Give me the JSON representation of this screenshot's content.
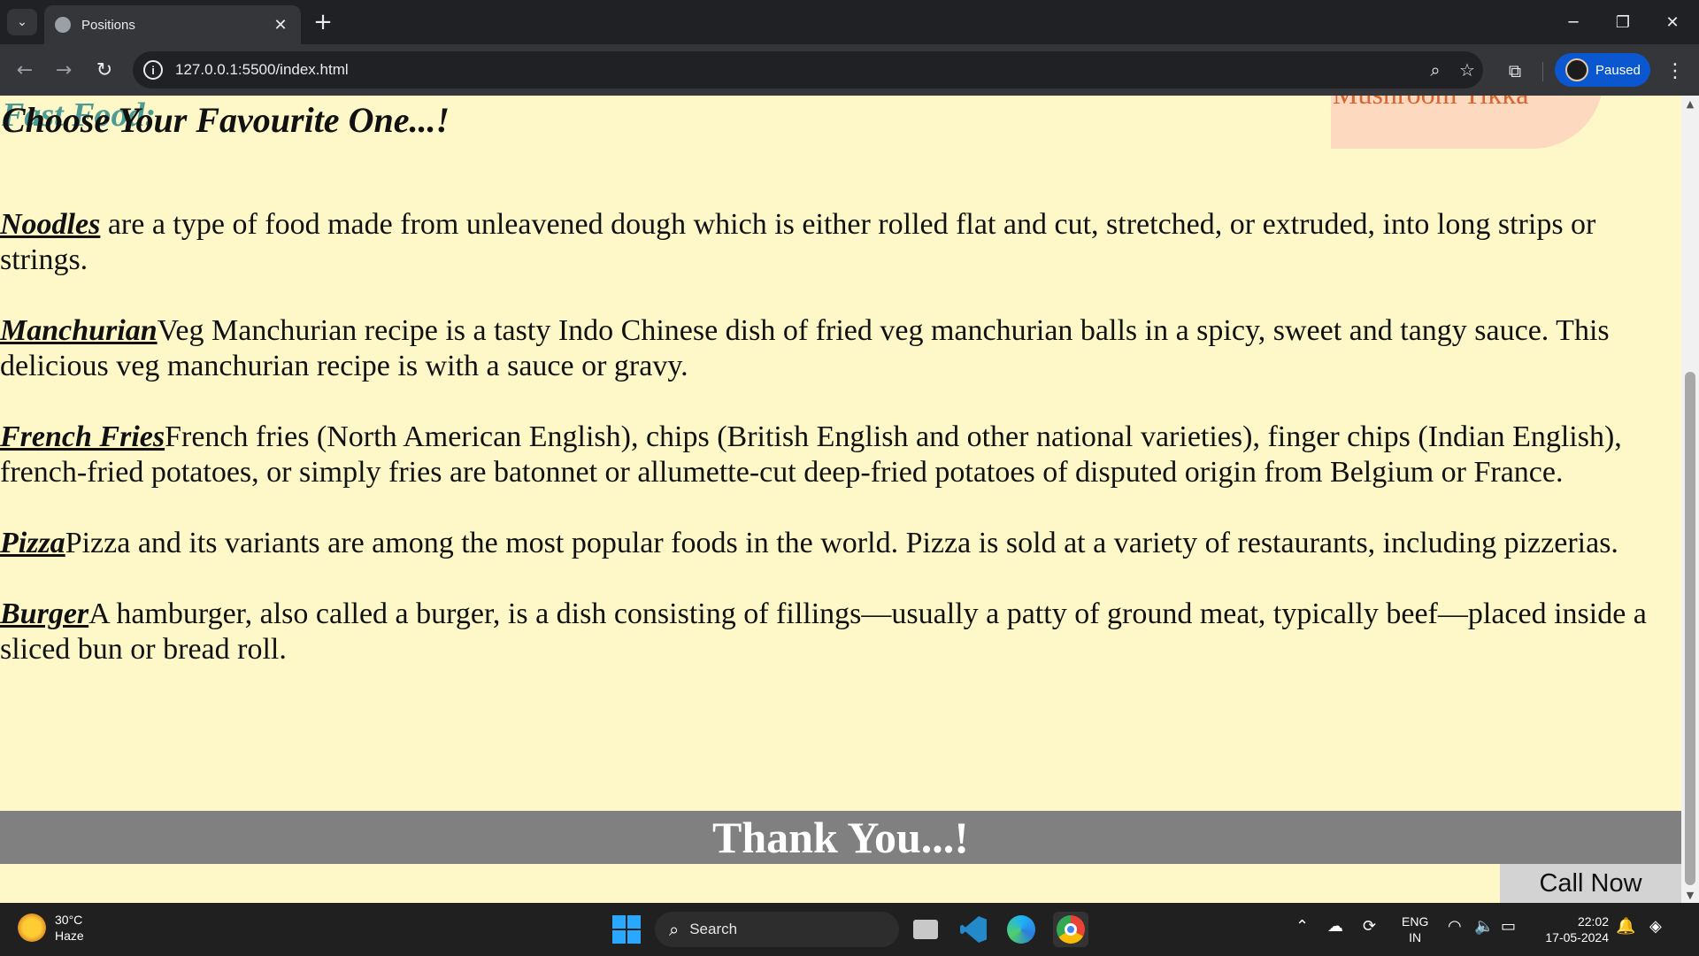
{
  "browser": {
    "tab_title": "Positions",
    "tab_close": "✕",
    "new_tab": "+",
    "url": "127.0.0.1:5500/index.html",
    "profile_label": "Paused",
    "window_min": "─",
    "window_restore": "❐",
    "window_close": "✕"
  },
  "page": {
    "heading_behind": "Fast Food:",
    "heading": "Choose Your Favourite One...!",
    "mushroom_label": "Mushroom Tikka",
    "items": [
      {
        "term": "Noodles",
        "text": " are a type of food made from unleavened dough which is either rolled flat and cut, stretched, or extruded, into long strips or strings."
      },
      {
        "term": "Manchurian",
        "text": "Veg Manchurian recipe is a tasty Indo Chinese dish of fried veg manchurian balls in a spicy, sweet and tangy sauce. This delicious veg manchurian recipe is with a sauce or gravy."
      },
      {
        "term": "French Fries",
        "text": "French fries (North American English), chips (British English and other national varieties), finger chips (Indian English), french-fried potatoes, or simply fries are batonnet or allumette-cut deep-fried potatoes of disputed origin from Belgium or France."
      },
      {
        "term": "Pizza",
        "text": "Pizza and its variants are among the most popular foods in the world. Pizza is sold at a variety of restaurants, including pizzerias."
      },
      {
        "term": "Burger",
        "text": "A hamburger, also called a burger, is a dish consisting of fillings—usually a patty of ground meat, typically beef—placed inside a sliced bun or bread roll."
      }
    ],
    "footer": "Thank You...!",
    "call_now": "Call Now"
  },
  "taskbar": {
    "weather_temp": "30°C",
    "weather_desc": "Haze",
    "search_label": "Search",
    "lang_top": "ENG",
    "lang_bottom": "IN",
    "time": "22:02",
    "date": "17-05-2024"
  },
  "colors": {
    "page_bg": "#fef8c9",
    "footer_bg": "#808080",
    "accent_teal": "#2e8b8b",
    "mushroom_text": "#d9642d"
  }
}
